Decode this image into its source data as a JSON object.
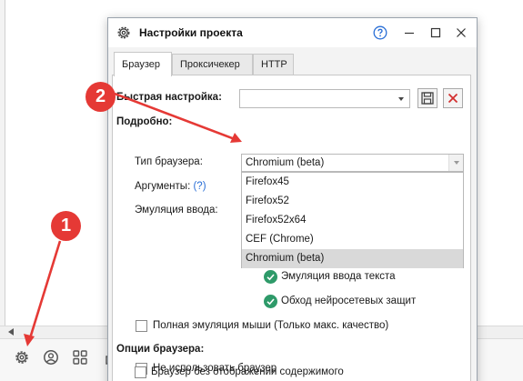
{
  "dialog": {
    "title": "Настройки проекта",
    "tabs": [
      {
        "label": "Браузер",
        "active": true
      },
      {
        "label": "Проксичекер",
        "active": false
      },
      {
        "label": "HTTP",
        "active": false
      }
    ]
  },
  "quick_setup": {
    "label": "Быстрая настройка:",
    "value": ""
  },
  "details": {
    "heading": "Подробно:",
    "browser_type_label": "Тип браузера:",
    "browser_type_value": "Chromium (beta)",
    "arguments_label": "Аргументы:",
    "arguments_help": "(?)",
    "input_emulation_label": "Эмуляция ввода:"
  },
  "browser_dropdown": {
    "options": [
      "Firefox45",
      "Firefox52",
      "Firefox52x64",
      "CEF (Chrome)",
      "Chromium (beta)"
    ],
    "selected": "Chromium (beta)"
  },
  "toggles": [
    {
      "label": "Эмуляция ввода текста",
      "checked": true
    },
    {
      "label": "Обход нейросетевых защит",
      "checked": true
    }
  ],
  "full_mouse_emulation": {
    "label": "Полная эмуляция мыши (Только макс. качество)",
    "checked": false
  },
  "browser_options": {
    "heading": "Опции браузера:",
    "items": [
      {
        "label": "Не использовать браузер",
        "checked": false
      },
      {
        "label": "Браузер без отображения содержимого",
        "checked": false
      }
    ]
  },
  "markers": {
    "one": "1",
    "two": "2"
  },
  "colors": {
    "marker": "#e53935",
    "check": "#2e9a69",
    "accent": "#2a6fd6"
  },
  "icons": [
    "gear-icon",
    "help-icon",
    "minimize-icon",
    "maximize-icon",
    "close-icon",
    "save-icon",
    "delete-icon",
    "user-icon",
    "grid-icon"
  ]
}
